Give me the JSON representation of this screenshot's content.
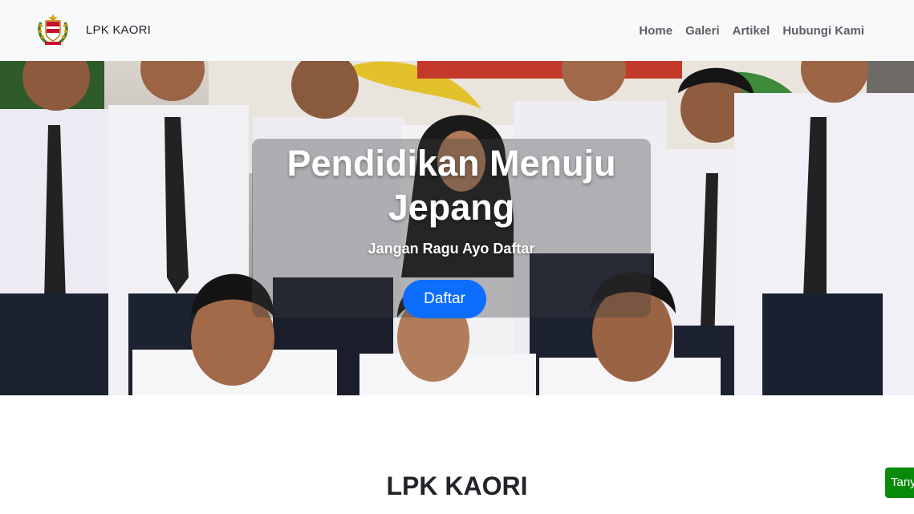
{
  "navbar": {
    "brand_text": "LPK KAORI",
    "links": [
      "Home",
      "Galeri",
      "Artikel",
      "Hubungi Kami"
    ]
  },
  "hero": {
    "title": "Pendidikan Menuju Jepang",
    "subtitle": "Jangan Ragu Ayo Daftar",
    "button_label": "Daftar"
  },
  "section": {
    "title": "LPK KAORI"
  },
  "chat_tab": {
    "label": "Tanya"
  },
  "colors": {
    "navbar_bg": "#f8f9fa",
    "primary_button": "#0d6efd",
    "chat_tab": "#0a8a0a",
    "text_dark": "#212529"
  },
  "icons": {
    "brand_logo": "emblem-logo"
  }
}
